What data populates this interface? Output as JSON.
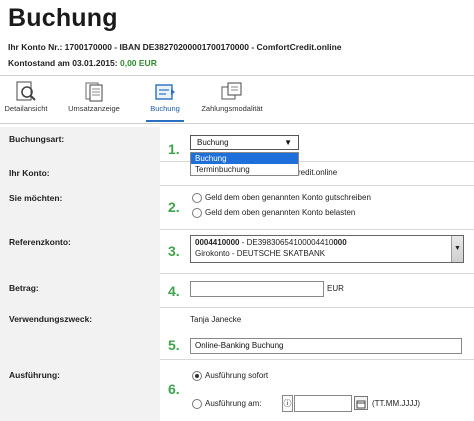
{
  "header": {
    "title": "Buchung",
    "account_line": "Ihr Konto Nr.: 1700170000 - IBAN DE38270200001700170000 - ComfortCredit.online",
    "balance_label": "Kontostand am 03.01.2015:",
    "balance_value": "0,00 EUR"
  },
  "tabs": [
    {
      "label": "Detailansicht",
      "icon": "magnifier-document-icon"
    },
    {
      "label": "Umsatzanzeige",
      "icon": "documents-icon"
    },
    {
      "label": "Buchung",
      "icon": "booking-icon",
      "active": true
    },
    {
      "label": "Zahlungsmodalität",
      "icon": "payment-modality-icon"
    }
  ],
  "colors": {
    "accent": "#2a6fc0",
    "step_number": "#3fa34d",
    "balance": "#2e8b2e",
    "label_bg": "#f2f2f2",
    "highlight": "#1e6fd9"
  },
  "form": {
    "buchungsart": {
      "label": "Buchungsart:",
      "step": "1.",
      "selected": "Buchung",
      "options": [
        "Buchung",
        "Terminbuchung"
      ]
    },
    "ihr_konto": {
      "label": "Ihr Konto:",
      "value_partial": "redit.online"
    },
    "sie_moechten": {
      "label": "Sie möchten:",
      "step": "2.",
      "options": [
        "Geld dem oben genannten Konto gutschreiben",
        "Geld dem oben genannten Konto belasten"
      ]
    },
    "referenzkonto": {
      "label": "Referenzkonto:",
      "step": "3.",
      "line1_bold": "0004410000",
      "line1_mid": " - DE39830654100004410",
      "line1_bold_end": "000",
      "line2": "Girokonto - DEUTSCHE SKATBANK"
    },
    "betrag": {
      "label": "Betrag:",
      "step": "4.",
      "value": "",
      "currency": "EUR"
    },
    "verwendungszweck": {
      "label": "Verwendungszweck:",
      "name": "Tanja Janecke",
      "step": "5.",
      "value": "Online-Banking Buchung"
    },
    "ausfuehrung": {
      "label": "Ausführung:",
      "step": "6.",
      "option_now": "Ausführung sofort",
      "option_date": "Ausführung am:",
      "date_value": "",
      "date_format": "(TT.MM.JJJJ)"
    }
  }
}
